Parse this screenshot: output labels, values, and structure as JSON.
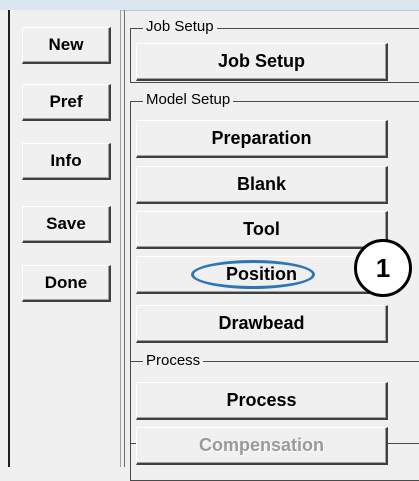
{
  "sidebar": {
    "buttons": [
      {
        "label": "New"
      },
      {
        "label": "Pref"
      },
      {
        "label": "Info"
      },
      {
        "label": "Save"
      },
      {
        "label": "Done"
      }
    ]
  },
  "job_setup": {
    "group_label": "Job Setup",
    "buttons": [
      {
        "label": "Job Setup"
      }
    ]
  },
  "model_setup": {
    "group_label": "Model Setup",
    "buttons": [
      {
        "label": "Preparation"
      },
      {
        "label": "Blank"
      },
      {
        "label": "Tool"
      },
      {
        "label": "Position"
      },
      {
        "label": "Drawbead"
      }
    ]
  },
  "process": {
    "group_label": "Process",
    "buttons": [
      {
        "label": "Process"
      },
      {
        "label": "Compensation",
        "disabled": true
      }
    ]
  },
  "callout": {
    "number": "1",
    "highlight_color": "#2e75b6"
  }
}
